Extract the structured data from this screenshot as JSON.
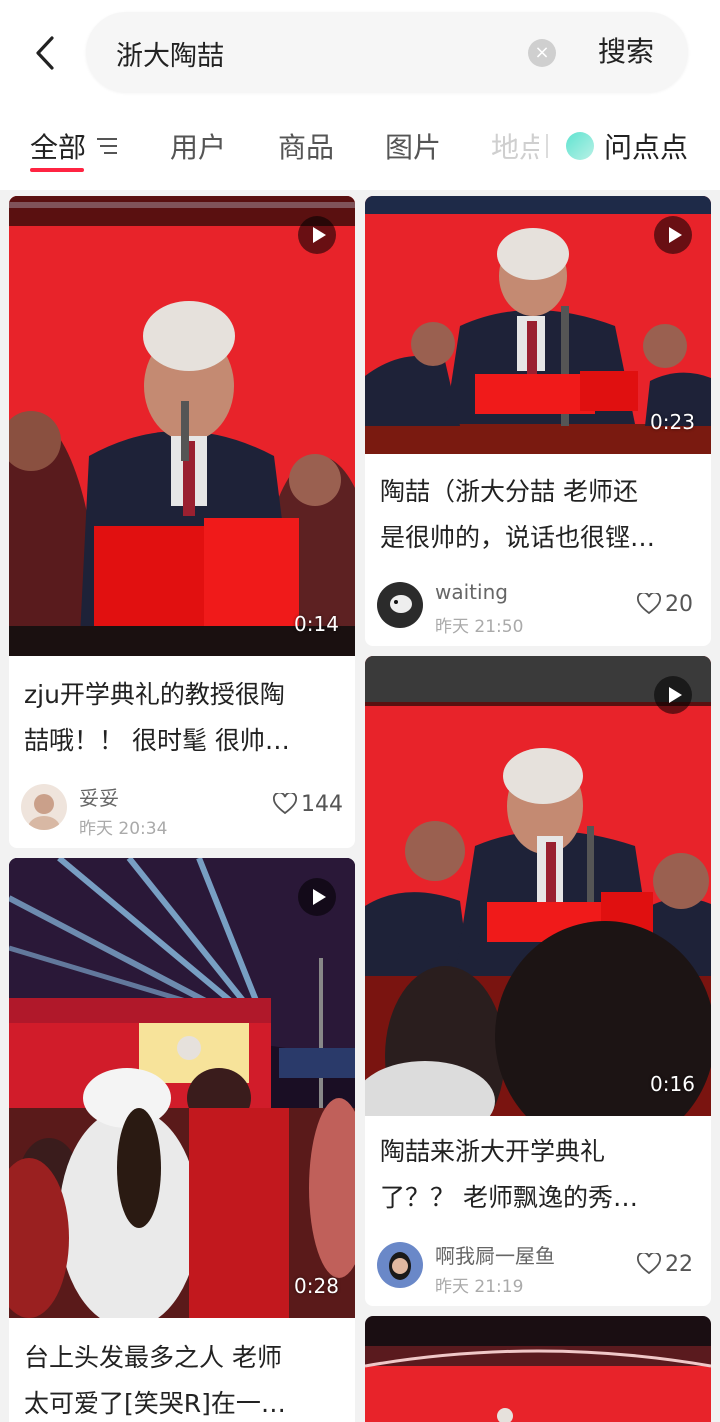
{
  "search": {
    "query": "浙大陶喆",
    "clear_label": "×",
    "submit_label": "搜索"
  },
  "tabs": [
    {
      "label": "全部",
      "active": true
    },
    {
      "label": "用户"
    },
    {
      "label": "商品"
    },
    {
      "label": "图片"
    },
    {
      "label": "地点"
    },
    {
      "label": "问点点"
    }
  ],
  "colors": {
    "accent": "#ff2442",
    "stage_red": "#e8232a"
  },
  "feed": [
    {
      "title_line1": "zju开学典礼的教授很陶",
      "title_line2": "喆哦！！ 很时髦 很帅…",
      "duration": "0:14",
      "author": "妥妥",
      "time": "昨天 20:34",
      "likes": "144"
    },
    {
      "title_line1": "陶喆（浙大分喆 老师还",
      "title_line2": "是很帅的，说话也很铿…",
      "duration": "0:23",
      "author": "waiting",
      "time": "昨天 21:50",
      "likes": "20"
    },
    {
      "title_line1": "陶喆来浙大开学典礼",
      "title_line2": "了？？ 老师飘逸的秀…",
      "duration": "0:16",
      "author": "啊我屙一屋鱼",
      "time": "昨天 21:19",
      "likes": "22"
    },
    {
      "title_line1": "台上头发最多之人 老师",
      "title_line2": "太可爱了[笑哭R]在一…",
      "duration": "0:28"
    }
  ]
}
